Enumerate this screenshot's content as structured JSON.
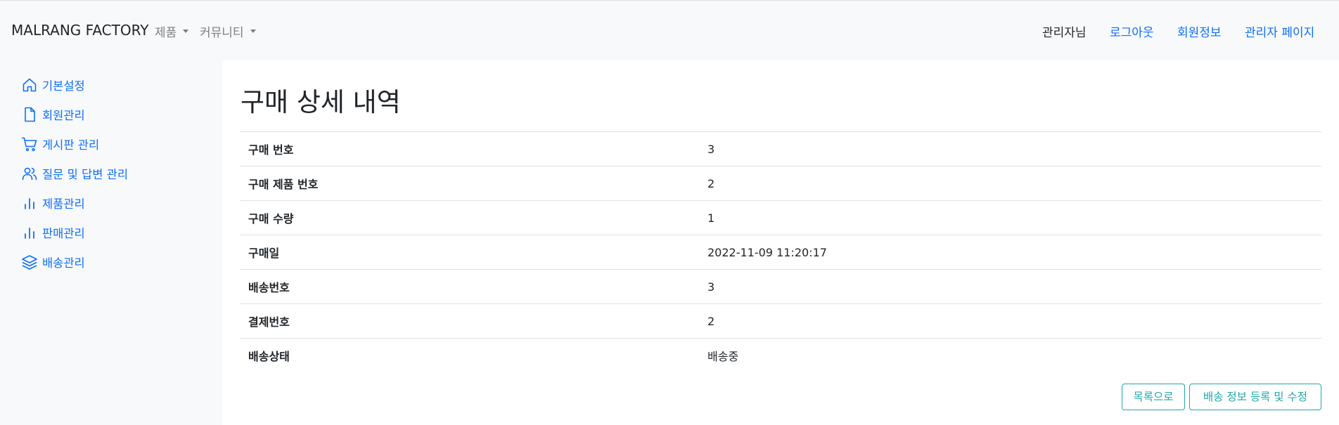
{
  "navbar": {
    "brand": "MALRANG FACTORY",
    "dropdowns": [
      {
        "label": "제품"
      },
      {
        "label": "커뮤니티"
      }
    ],
    "user_greeting": "관리자님",
    "links": [
      {
        "label": "로그아웃"
      },
      {
        "label": "회원정보"
      },
      {
        "label": "관리자 페이지"
      }
    ],
    "colors": {
      "link": "#0d6efd",
      "muted": "#7a7f85"
    }
  },
  "sidebar": {
    "items": [
      {
        "label": "기본설정",
        "icon": "home-icon"
      },
      {
        "label": "회원관리",
        "icon": "file-icon"
      },
      {
        "label": "게시판 관리",
        "icon": "cart-icon"
      },
      {
        "label": "질문 및 답변 관리",
        "icon": "users-icon"
      },
      {
        "label": "제품관리",
        "icon": "bar-chart-icon"
      },
      {
        "label": "판매관리",
        "icon": "bar-chart-icon"
      },
      {
        "label": "배송관리",
        "icon": "layers-icon"
      }
    ]
  },
  "main": {
    "title": "구매 상세 내역",
    "rows": [
      {
        "label": "구매 번호",
        "value": "3"
      },
      {
        "label": "구매 제품 번호",
        "value": "2"
      },
      {
        "label": "구매 수량",
        "value": "1"
      },
      {
        "label": "구매일",
        "value": "2022-11-09 11:20:17"
      },
      {
        "label": "배송번호",
        "value": "3"
      },
      {
        "label": "결제번호",
        "value": "2"
      },
      {
        "label": "배송상태",
        "value": "배송중"
      }
    ],
    "buttons": {
      "list": "목록으로",
      "shipping": "배송 정보 등록 및 수정"
    },
    "colors": {
      "button": "#20a7a7"
    }
  }
}
